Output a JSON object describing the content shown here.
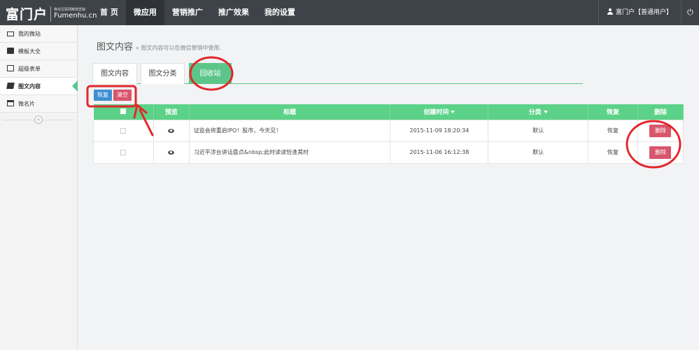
{
  "header": {
    "logo": {
      "main": "富门户",
      "tagline": "移动互联网精准营销",
      "domain": "Fumenhu.cn"
    },
    "nav": [
      {
        "label": "首 页"
      },
      {
        "label": "微应用"
      },
      {
        "label": "营销推广"
      },
      {
        "label": "推广效果"
      },
      {
        "label": "我的设置"
      }
    ],
    "active_nav": "微应用",
    "user_label": "富门户【普通用户】",
    "power_icon": "power-icon"
  },
  "sidebar": {
    "items": [
      {
        "label": "我的微站",
        "icon": "monitor-icon"
      },
      {
        "label": "模板大全",
        "icon": "folder-icon"
      },
      {
        "label": "超级表单",
        "icon": "calendar-icon"
      },
      {
        "label": "图文内容",
        "icon": "book-icon"
      },
      {
        "label": "微名片",
        "icon": "card-icon"
      }
    ],
    "active": "图文内容",
    "collapse_glyph": "«"
  },
  "main": {
    "title": "图文内容",
    "description": "» 图文内容可以在微信营销中使用.",
    "tabs": [
      {
        "label": "图文内容"
      },
      {
        "label": "图文分类"
      },
      {
        "label": "回收站"
      }
    ],
    "active_tab": "回收站",
    "actions": {
      "restore": "恢复",
      "clear": "清空"
    },
    "table": {
      "headers": [
        "",
        "预览",
        "标题",
        "创建时间",
        "分类",
        "恢复",
        "删除"
      ],
      "rows": [
        {
          "title": "证监会将重启IPO！股市，今天见！",
          "created": "2015-11-09 18:20:34",
          "category": "默认",
          "restore": "恢复",
          "delete": "删除"
        },
        {
          "title": "习近平涉台讲话盘点&nbsp;此时读读恰逢其时",
          "created": "2015-11-06 16:12:38",
          "category": "默认",
          "restore": "恢复",
          "delete": "删除"
        }
      ]
    }
  },
  "colors": {
    "topbar": "#3e4249",
    "accent_green": "#5cd188",
    "restore_blue": "#3f8fd2",
    "danger_red": "#d8566b",
    "annotation_red": "#e2262a"
  }
}
